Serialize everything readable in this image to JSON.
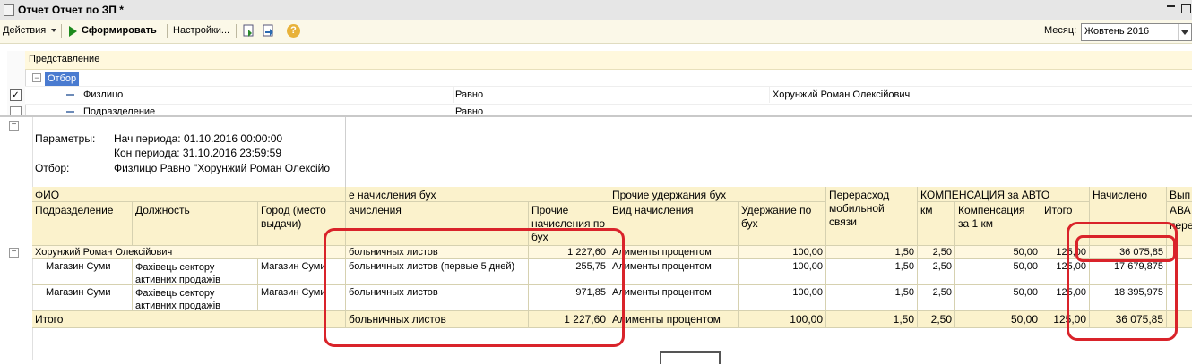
{
  "window": {
    "title": "Отчет  Отчет по ЗП *"
  },
  "toolbar": {
    "actions_label": "Действия",
    "generate_label": "Сформировать",
    "settings_label": "Настройки...",
    "help_glyph": "?",
    "month_label": "Месяц:",
    "month_value": "Жовтень 2016"
  },
  "settings": {
    "column_header": "Представление",
    "filter_label": "Отбор",
    "row1": {
      "field": "Физлицо",
      "comparison": "Равно",
      "value": "Хорунжий Роман Олексійович",
      "checked": true
    },
    "row2": {
      "field": "Подразделение",
      "comparison": "Равно"
    }
  },
  "report": {
    "params_label": "Параметры:",
    "period_start": "Нач периода: 01.10.2016 00:00:00",
    "period_end": "Кон периода: 31.10.2016 23:59:59",
    "filter_label": "Отбор:",
    "filter_value": "Физлицо Равно \"Хорунжий Роман Олексійо",
    "headers": {
      "fio": "ФИО",
      "division": "Подразделение",
      "position": "Должность",
      "city": "Город (место выдачи)",
      "accruals_group": "е начисления бух",
      "accrual_kind": "ачисления",
      "other_accruals": "Прочие начисления по бух",
      "deductions_group": "Прочие удержания бух",
      "deduction_kind": "Вид начисления",
      "deduction_amount": "Удержание по бух",
      "mobile_overspend": "Перерасход мобильной связи",
      "compensation_group": "КОМПЕНСАЦИЯ за АВТО",
      "km": "км",
      "comp_per_km": "Компенсация за 1 км",
      "comp_total": "Итого",
      "accrued": "Начислено",
      "extra1": "Вып",
      "extra2": "АВА",
      "extra3": "пере"
    },
    "rows": [
      {
        "fio": "Хорунжий Роман Олексійович",
        "division": "",
        "position": "",
        "city": "",
        "accrual_kind": "больничных листов",
        "other_accruals": "1 227,60",
        "deduction_kind": "Алименты процентом",
        "deduction_amount": "100,00",
        "mobile": "1,50",
        "km": "2,50",
        "comp_per_km": "50,00",
        "comp_total": "125,00",
        "accrued": "36 075,85"
      },
      {
        "fio": "",
        "division": "Магазин Суми",
        "position": "Фахівець сектору активних продажів",
        "city": "Магазин Суми",
        "accrual_kind": "больничных листов (первые 5 дней)",
        "other_accruals": "255,75",
        "deduction_kind": "Алименты процентом",
        "deduction_amount": "100,00",
        "mobile": "1,50",
        "km": "2,50",
        "comp_per_km": "50,00",
        "comp_total": "125,00",
        "accrued": "17 679,875"
      },
      {
        "fio": "",
        "division": "Магазин Суми",
        "position": "Фахівець сектору активних продажів",
        "city": "Магазин Суми",
        "accrual_kind": "больничных листов",
        "other_accruals": "971,85",
        "deduction_kind": "Алименты процентом",
        "deduction_amount": "100,00",
        "mobile": "1,50",
        "km": "2,50",
        "comp_per_km": "50,00",
        "comp_total": "125,00",
        "accrued": "18 395,975"
      }
    ],
    "total": {
      "label": "Итого",
      "accrual_kind": "больничных листов",
      "other_accruals": "1 227,60",
      "deduction_kind": "Алименты процентом",
      "deduction_amount": "100,00",
      "mobile": "1,50",
      "km": "2,50",
      "comp_per_km": "50,00",
      "comp_total": "125,00",
      "accrued": "36 075,85"
    }
  },
  "colors": {
    "annotation_red": "#d9232a",
    "header_bg": "#fbf2cc",
    "toolbar_bg": "#fbf8e8",
    "filter_highlight": "#4a7bd0"
  }
}
